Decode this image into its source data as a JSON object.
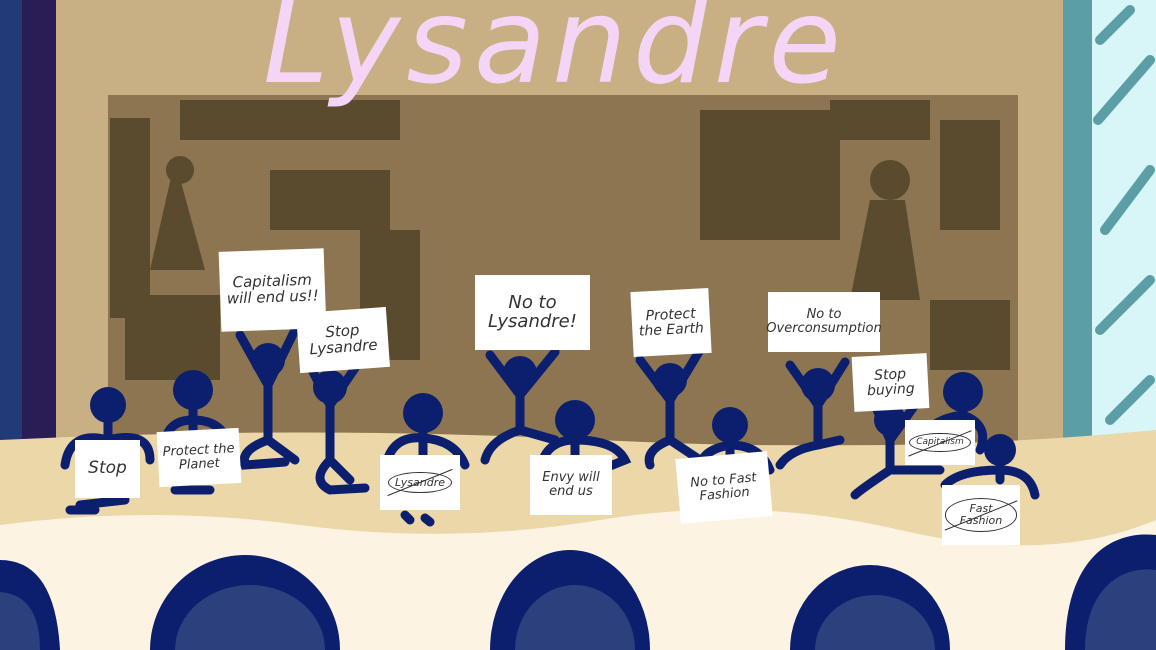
{
  "title": "Lysandre",
  "signs": {
    "s1": "Capitalism will end us!!",
    "s2": "Stop Lysandre",
    "s3": "No to Lysandre!",
    "s4": "Protect the Earth",
    "s5": "No to Overconsumption",
    "s6": "Stop buying",
    "s7": "Stop",
    "s8": "Protect the Planet",
    "s9": "Lysandre",
    "s10": "Envy will end us",
    "s11": "No to Fast Fashion",
    "s12": "Capitalism",
    "s13": "Fast Fashion"
  },
  "colors": {
    "protester": "#0b1f6e",
    "title": "#f4d5f5",
    "wall": "#c9af84",
    "backdrop": "#8c7550",
    "stage": "#ecd7a8",
    "audience_floor": "#fcf3e3"
  }
}
